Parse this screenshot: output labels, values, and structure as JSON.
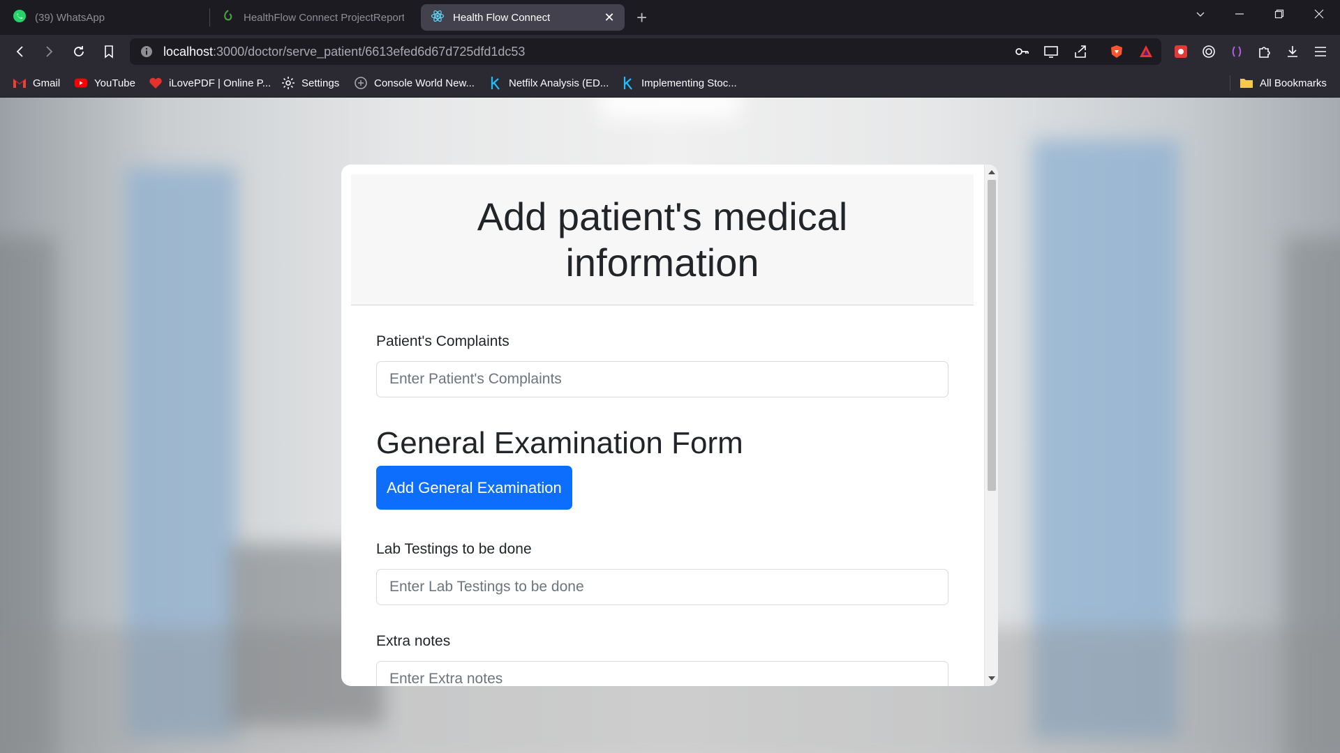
{
  "browser": {
    "tabs": [
      {
        "title": "(39) WhatsApp",
        "icon": "whatsapp-icon",
        "active": false
      },
      {
        "title": "HealthFlow Connect ProjectReport -",
        "icon": "overleaf-icon",
        "active": false
      },
      {
        "title": "Health Flow Connect",
        "icon": "react-icon",
        "active": true
      }
    ],
    "url": {
      "host": "localhost",
      "rest": ":3000/doctor/serve_patient/6613efed6d67d725dfd1dc53"
    },
    "bookmarks": [
      {
        "label": "Gmail",
        "icon": "gmail-icon"
      },
      {
        "label": "YouTube",
        "icon": "youtube-icon"
      },
      {
        "label": "iLovePDF | Online P...",
        "icon": "ilovepdf-icon"
      },
      {
        "label": "Settings",
        "icon": "gear-icon"
      },
      {
        "label": "Console World New...",
        "icon": "console-icon"
      },
      {
        "label": "Netfilx Analysis (ED...",
        "icon": "kaggle-icon"
      },
      {
        "label": "Implementing Stoc...",
        "icon": "kaggle-icon"
      }
    ],
    "all_bookmarks": "All Bookmarks",
    "colors": {
      "accent": "#0d6efd",
      "frame": "#1c1b22",
      "toolbar": "#2b2a33"
    }
  },
  "page": {
    "title": "Add patient's medical information",
    "complaints": {
      "label": "Patient's Complaints",
      "placeholder": "Enter Patient's Complaints"
    },
    "general_exam": {
      "title": "General Examination Form",
      "button": "Add General Examination"
    },
    "lab_tests": {
      "label": "Lab Testings to be done",
      "placeholder": "Enter Lab Testings to be done"
    },
    "extra_notes": {
      "label": "Extra notes",
      "placeholder": "Enter Extra notes"
    }
  }
}
